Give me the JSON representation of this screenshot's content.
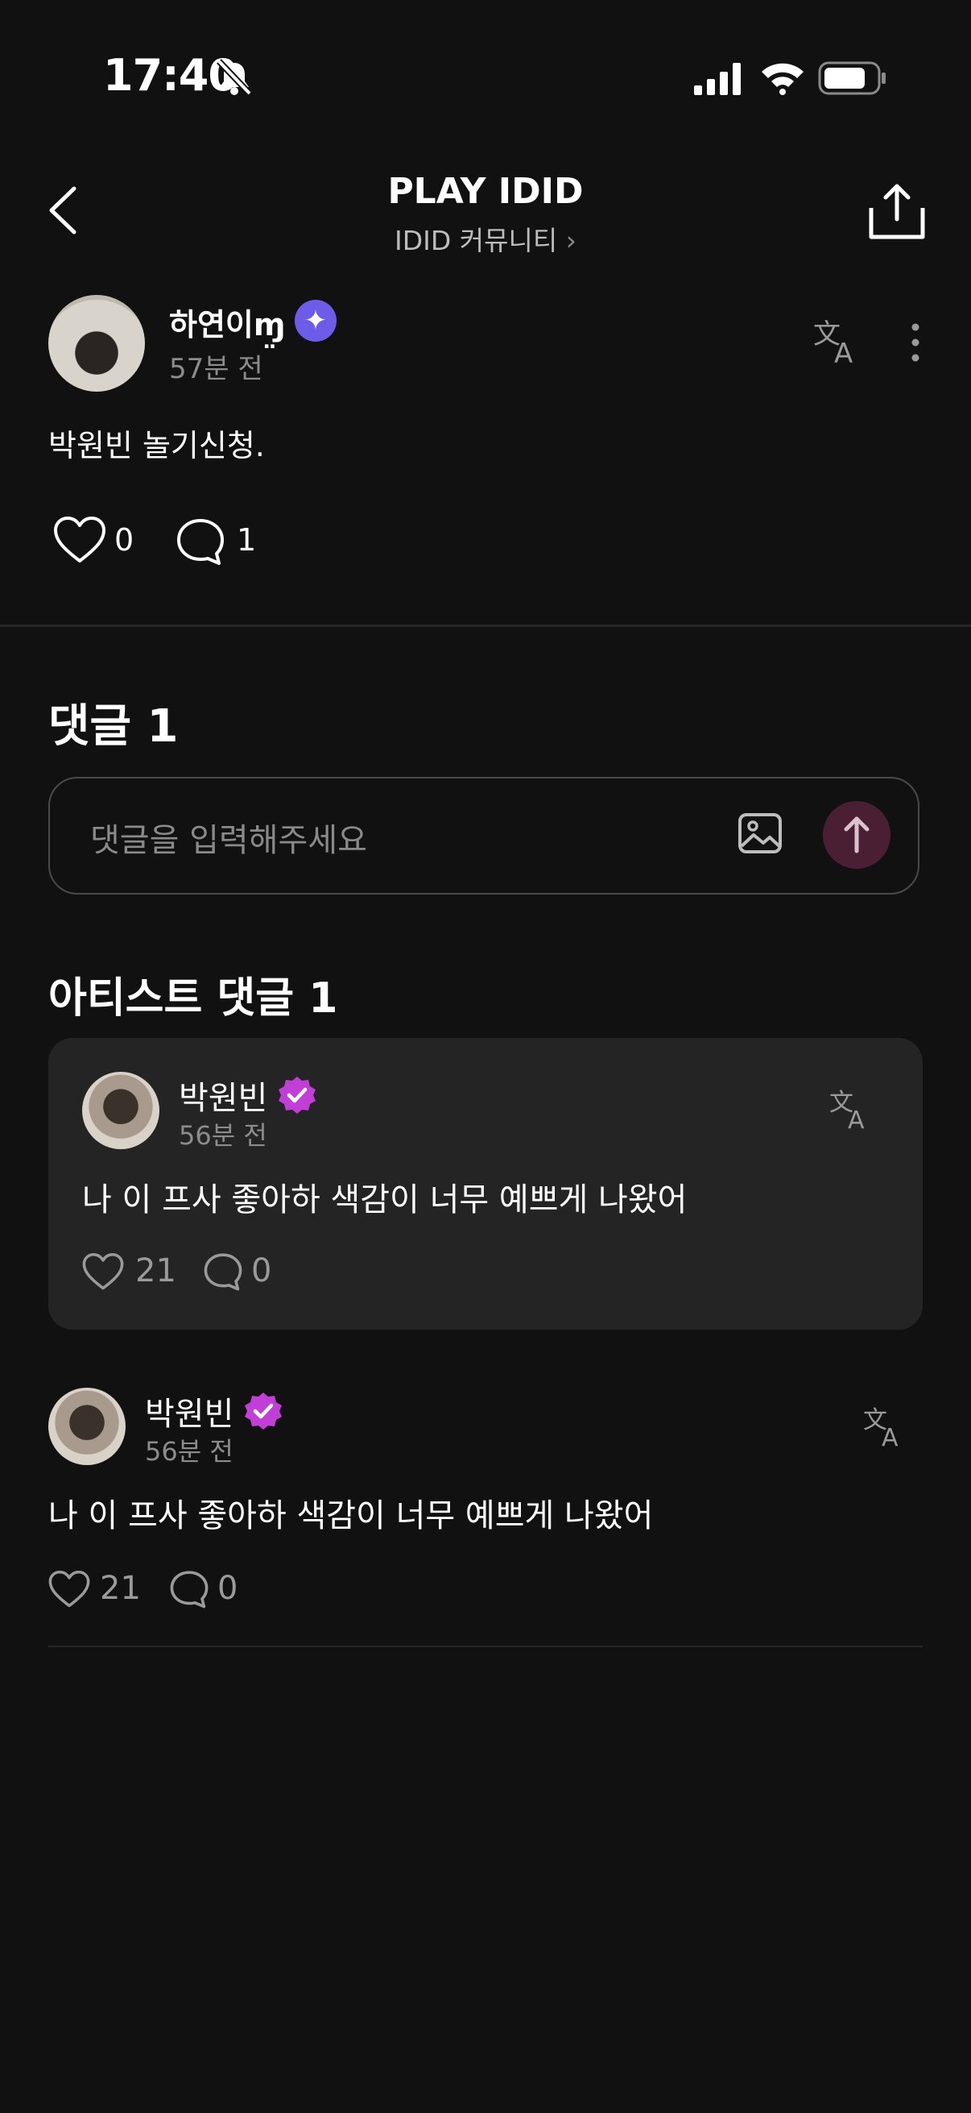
{
  "status_bar": {
    "time": "17:40"
  },
  "header": {
    "title": "PLAY IDID",
    "subtitle": "IDID 커뮤니티"
  },
  "post": {
    "author": "하연이ɱ̤",
    "time": "57분 전",
    "text": "박원빈 놀기신청.",
    "likes": "0",
    "comments": "1"
  },
  "comments_section": {
    "heading": "댓글 1",
    "input_placeholder": "댓글을 입력해주세요"
  },
  "artist_section": {
    "heading": "아티스트 댓글 1"
  },
  "artist_comment": {
    "author": "박원빈",
    "time": "56분 전",
    "text": "나 이 프사 좋아하 색감이 너무 예쁘게 나왔어",
    "likes": "21",
    "replies": "0"
  },
  "comment": {
    "author": "박원빈",
    "time": "56분 전",
    "text": "나 이 프사 좋아하 색감이 너무 예쁘게 나왔어",
    "likes": "21",
    "replies": "0"
  },
  "icons": {
    "back": "chevron-left-icon",
    "share": "share-icon",
    "translate": "translate-icon",
    "more": "more-vertical-icon",
    "like": "heart-icon",
    "comment": "comment-icon",
    "image": "image-icon",
    "send": "arrow-up-icon",
    "verified": "verified-badge-icon"
  },
  "colors": {
    "background": "#111111",
    "card": "#242424",
    "post_badge": "#6c5ce7",
    "verified": "#c13fd6",
    "send_button": "#4a1f33"
  }
}
